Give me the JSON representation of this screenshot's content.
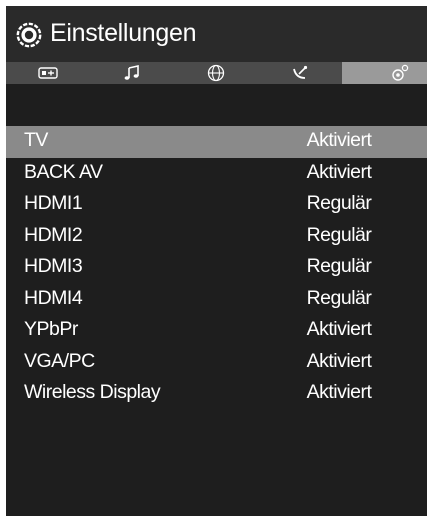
{
  "header": {
    "title": "Einstellungen",
    "icon": "gear-icon"
  },
  "tabs": [
    {
      "icon": "picture-input-icon",
      "active": false
    },
    {
      "icon": "music-note-icon",
      "active": false
    },
    {
      "icon": "globe-icon",
      "active": false
    },
    {
      "icon": "satellite-dish-icon",
      "active": false
    },
    {
      "icon": "settings-gear-icon",
      "active": true
    }
  ],
  "sources": [
    {
      "name": "TV",
      "value": "Aktiviert",
      "selected": true
    },
    {
      "name": "BACK AV",
      "value": "Aktiviert",
      "selected": false
    },
    {
      "name": "HDMI1",
      "value": "Regulär",
      "selected": false
    },
    {
      "name": "HDMI2",
      "value": "Regulär",
      "selected": false
    },
    {
      "name": "HDMI3",
      "value": "Regulär",
      "selected": false
    },
    {
      "name": "HDMI4",
      "value": "Regulär",
      "selected": false
    },
    {
      "name": "YPbPr",
      "value": "Aktiviert",
      "selected": false
    },
    {
      "name": "VGA/PC",
      "value": "Aktiviert",
      "selected": false
    },
    {
      "name": "Wireless Display",
      "value": "Aktiviert",
      "selected": false
    }
  ],
  "colors": {
    "background": "#1e1e1e",
    "header": "#2a2a2a",
    "tabbar": "#4b4b4b",
    "active_tab": "#9a9a9a",
    "selected_row": "#8a8a8a",
    "text": "#ffffff"
  }
}
